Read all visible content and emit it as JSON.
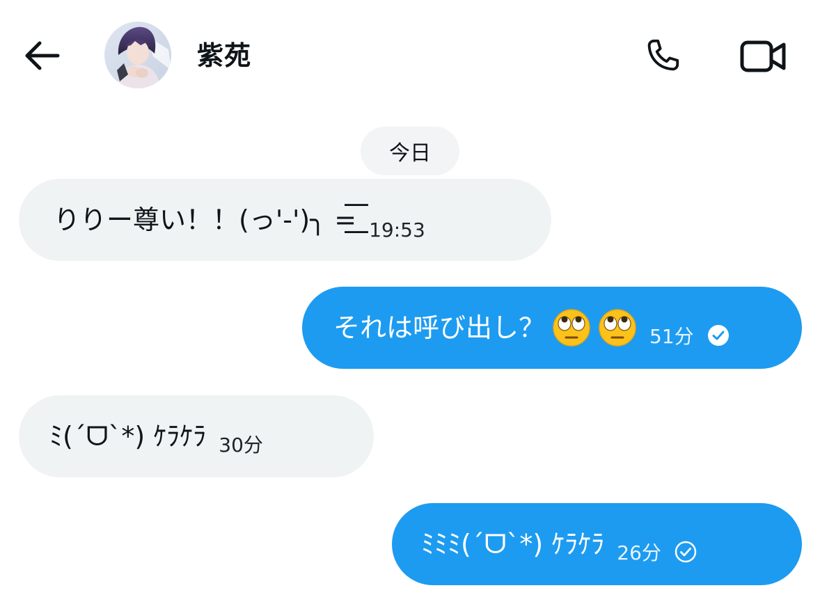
{
  "header": {
    "back_icon": "arrow-left-icon",
    "contact_name": "紫苑",
    "call_icon": "phone-icon",
    "video_icon": "video-camera-icon"
  },
  "date_separator": "今日",
  "messages": [
    {
      "direction": "incoming",
      "text": "りりー尊い！！(っ'-')╮ =͟͟͞͞",
      "time": "19:53"
    },
    {
      "direction": "outgoing",
      "text": "それは呼び出し？",
      "emoji": [
        "face-with-rolling-eyes",
        "face-with-rolling-eyes"
      ],
      "time": "51分",
      "status": "read"
    },
    {
      "direction": "incoming",
      "text": "ﾐ(´ᗜ`*) ｹﾗｹﾗ",
      "time": "30分"
    },
    {
      "direction": "outgoing",
      "text": "ﾐﾐﾐ(´ᗜ`*) ｹﾗｹﾗ",
      "time": "26分",
      "status": "sent"
    }
  ],
  "colors": {
    "incoming_bubble": "#eff3f4",
    "outgoing_bubble": "#1d9bf0",
    "text": "#0f1419"
  }
}
